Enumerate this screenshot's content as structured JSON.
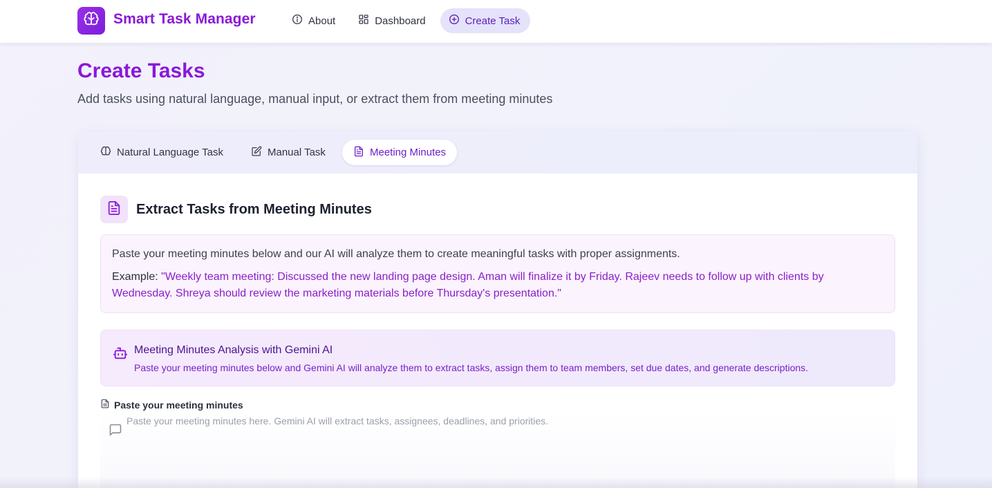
{
  "header": {
    "app_title": "Smart Task Manager",
    "logo_icon": "brain-icon",
    "nav": [
      {
        "label": "About",
        "icon": "info-icon",
        "active": false
      },
      {
        "label": "Dashboard",
        "icon": "grid-icon",
        "active": false
      },
      {
        "label": "Create Task",
        "icon": "plus-circle-icon",
        "active": true
      }
    ]
  },
  "page": {
    "title": "Create Tasks",
    "subtitle": "Add tasks using natural language, manual input, or extract them from meeting minutes"
  },
  "tabs": [
    {
      "label": "Natural Language Task",
      "icon": "brain-icon",
      "active": false
    },
    {
      "label": "Manual Task",
      "icon": "edit-icon",
      "active": false
    },
    {
      "label": "Meeting Minutes",
      "icon": "document-icon",
      "active": true
    }
  ],
  "section": {
    "icon": "document-icon",
    "title": "Extract Tasks from Meeting Minutes",
    "info_text": "Paste your meeting minutes below and our AI will analyze them to create meaningful tasks with proper assignments.",
    "example_label": "Example:",
    "example_text": "\"Weekly team meeting: Discussed the new landing page design. Aman will finalize it by Friday. Rajeev needs to follow up with clients by Wednesday. Shreya should review the marketing materials before Thursday's presentation.\""
  },
  "gemini": {
    "icon": "bot-icon",
    "title": "Meeting Minutes Analysis with Gemini AI",
    "description": "Paste your meeting minutes below and Gemini AI will analyze them to extract tasks, assign them to team members, set due dates, and generate descriptions."
  },
  "form": {
    "label": "Paste your meeting minutes",
    "label_icon": "file-icon",
    "input_icon": "chat-icon",
    "placeholder": "Paste your meeting minutes here. Gemini AI will extract tasks, assignees, deadlines, and priorities.",
    "value": ""
  },
  "colors": {
    "brand": "#8a18d8",
    "active_nav_bg": "#e5e2fb",
    "accent_text": "#7a1fc9"
  }
}
